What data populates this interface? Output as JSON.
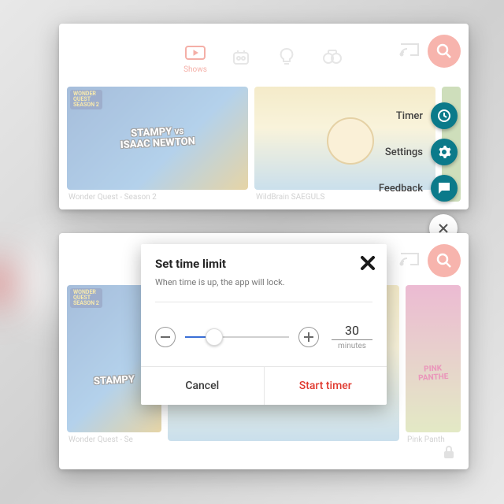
{
  "nav": {
    "active_tab_label": "Shows"
  },
  "fab": {
    "timer_label": "Timer",
    "settings_label": "Settings",
    "feedback_label": "Feedback"
  },
  "cards_top": [
    {
      "title": "Wonder Quest - Season 2",
      "overlay_line1": "STAMPY",
      "overlay_vs": "VS",
      "overlay_line2": "ISAAC NEWTON",
      "badge_line1": "WONDER",
      "badge_line2": "QUEST",
      "badge_sub": "SEASON 2"
    },
    {
      "title": "WildBrain SAEGULS"
    }
  ],
  "cards_bottom": [
    {
      "title": "Wonder Quest - Se",
      "overlay_line1": "STAMPY",
      "badge_line1": "WONDER",
      "badge_line2": "QUEST",
      "badge_sub": "SEASON 2"
    },
    {
      "title": ""
    },
    {
      "title": "Pink Panth",
      "overlay_line1": "PINK",
      "overlay_line2": "PANTHE"
    }
  ],
  "dialog": {
    "title": "Set time limit",
    "subtitle": "When time is up, the app will lock.",
    "value": "30",
    "unit": "minutes",
    "cancel_label": "Cancel",
    "start_label": "Start timer"
  },
  "colors": {
    "accent_red": "#ef5a4c",
    "teal": "#0b7a8a",
    "slider_blue": "#3b6fd6"
  }
}
